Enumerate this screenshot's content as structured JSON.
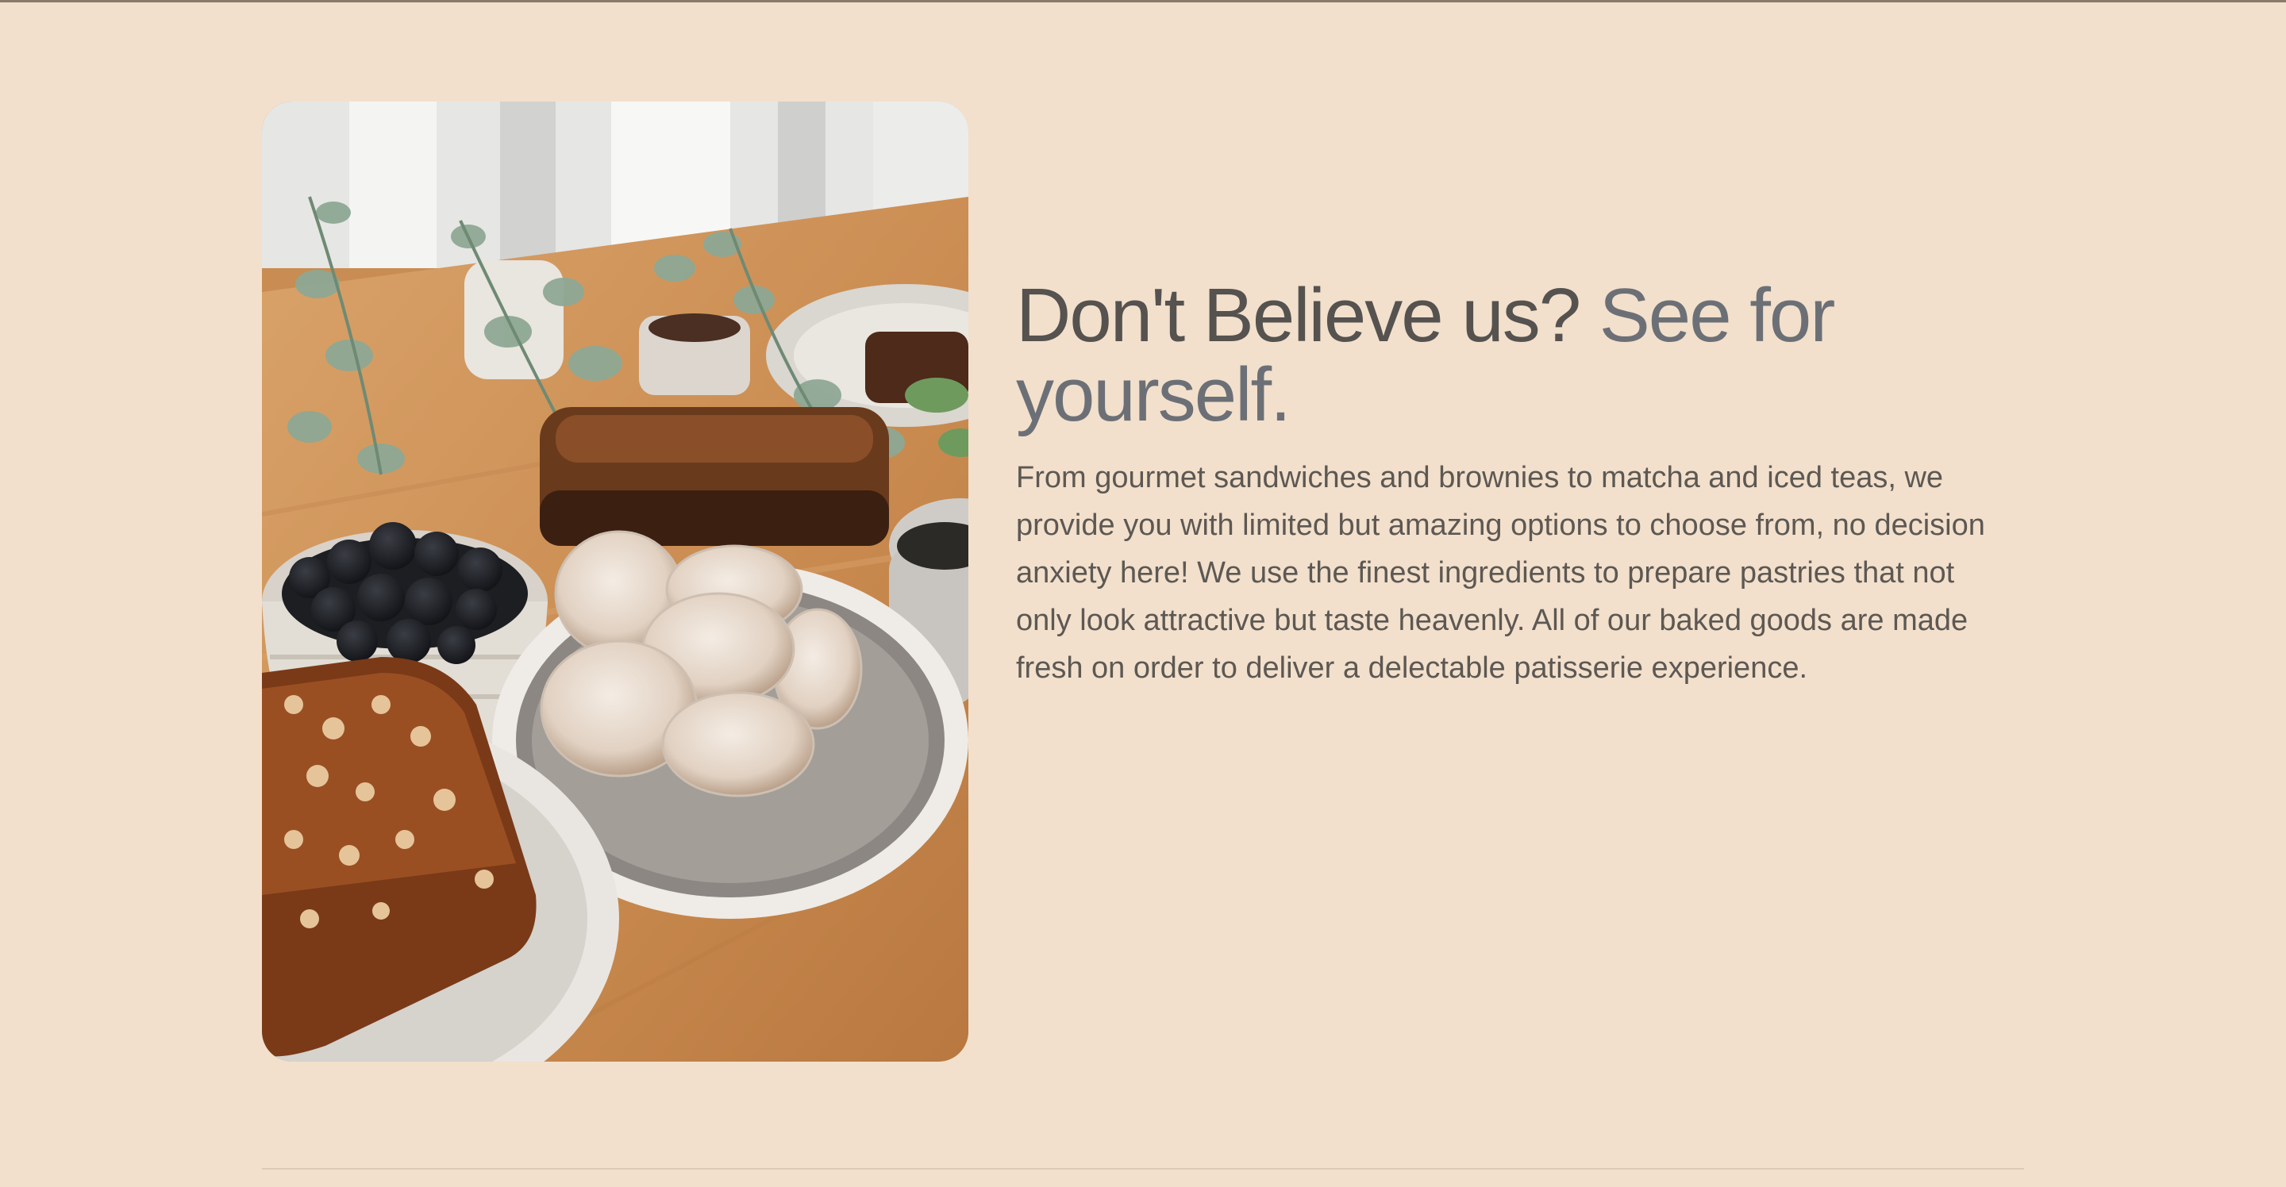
{
  "testimonial": {
    "headline_main": "Don't Believe us?",
    "headline_accent": "See for yourself.",
    "body": "From gourmet sandwiches and brownies to matcha and iced teas, we provide you with limited but amazing options to choose from, no decision anxiety here! We use the finest ingredients to prepare pastries that not only look attractive but taste heavenly. All of our baked goods are made fresh on order to deliver a delectable patisserie experience."
  },
  "colors": {
    "page_background": "#f2e0cc",
    "headline": "#55524f",
    "headline_accent": "#6c7076",
    "body_text": "#5d5853"
  }
}
